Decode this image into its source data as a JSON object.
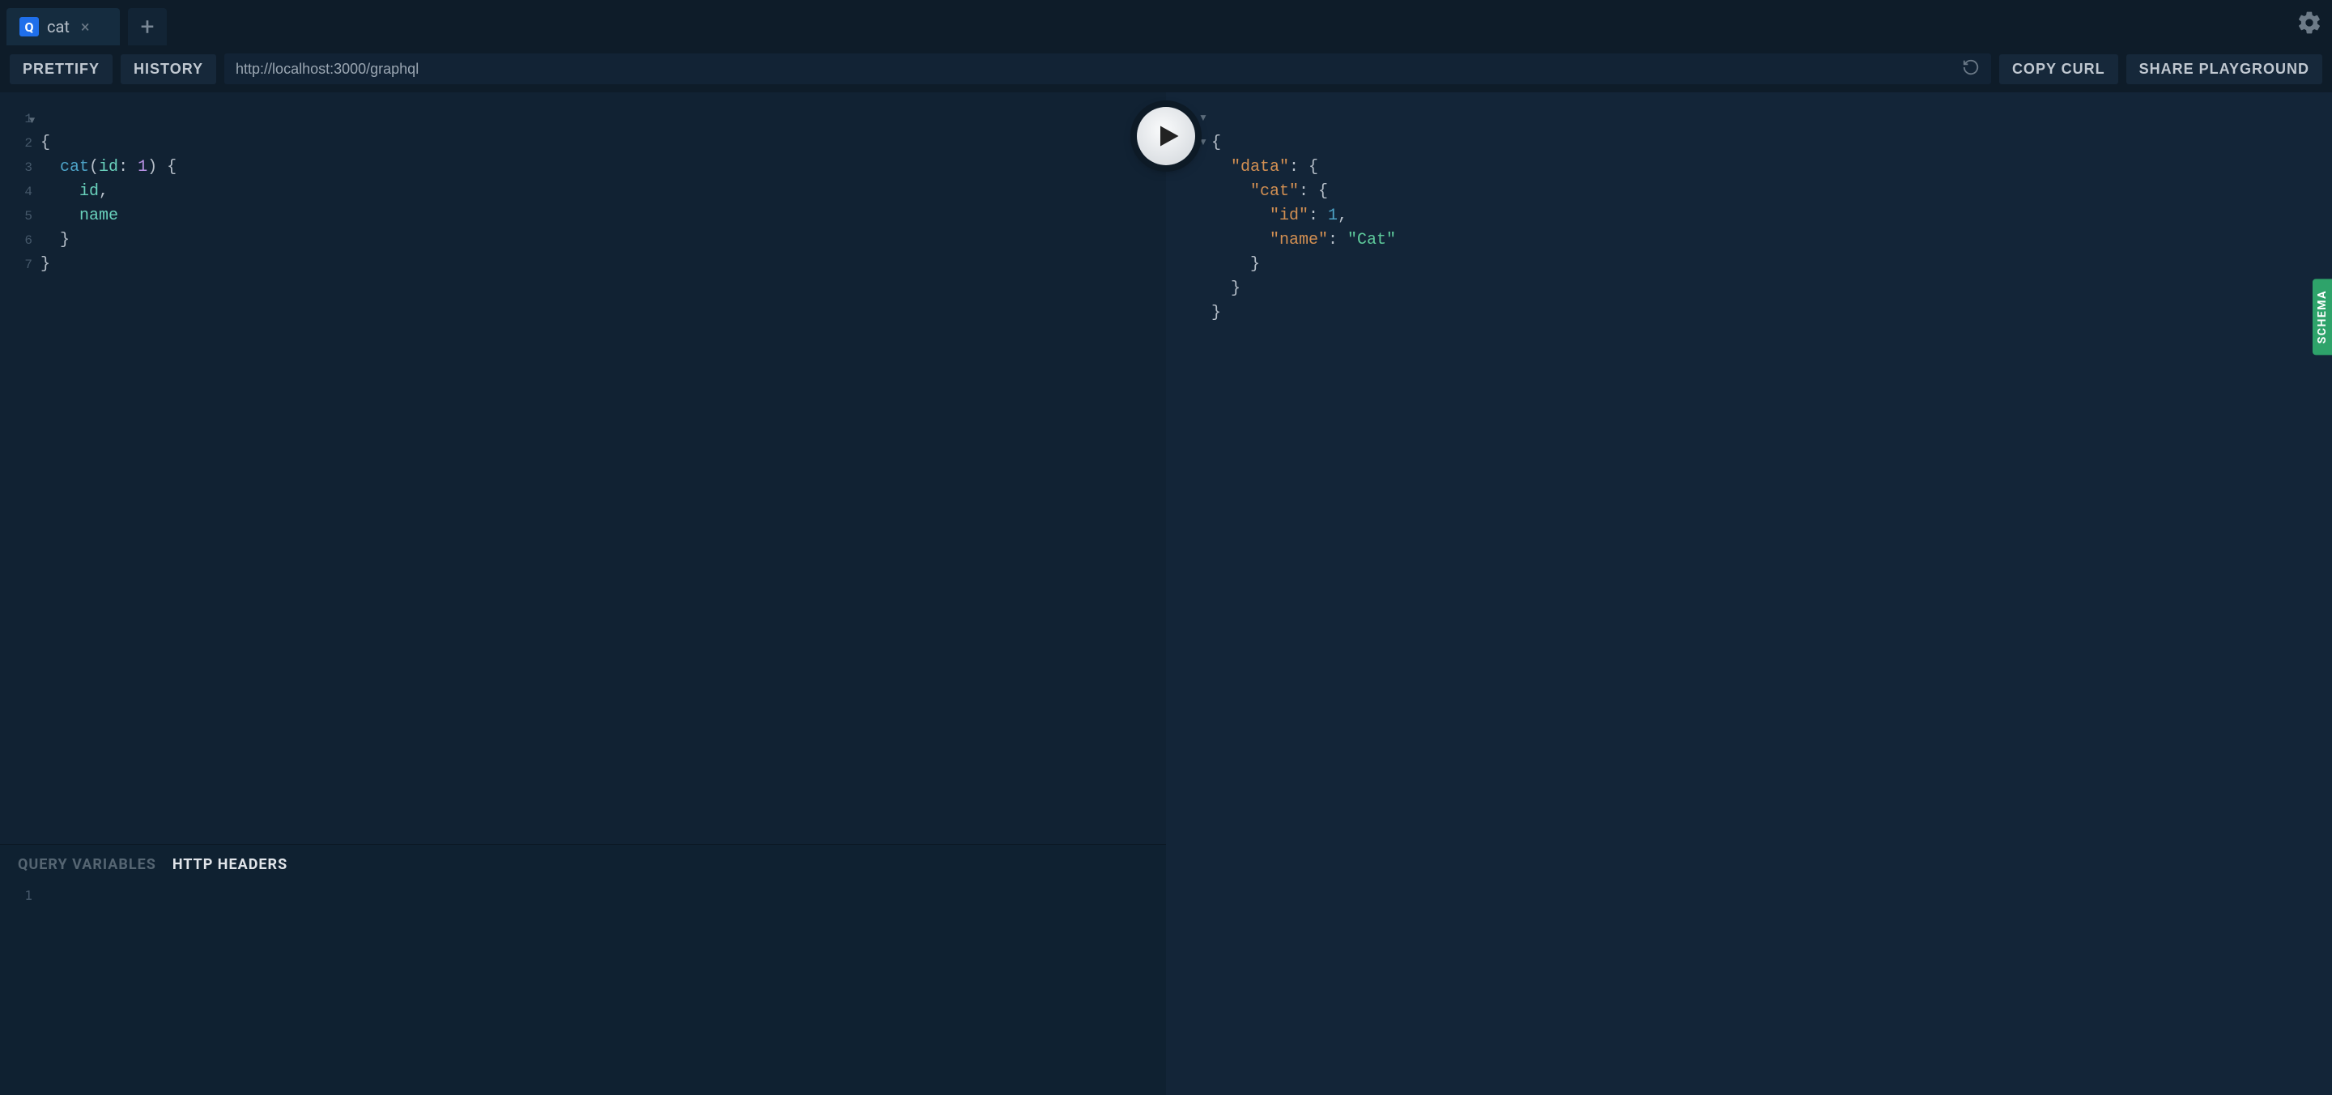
{
  "tabs": [
    {
      "badge": "Q",
      "title": "cat"
    }
  ],
  "toolbar": {
    "prettify": "PRETTIFY",
    "history": "HISTORY",
    "url": "http://localhost:3000/graphql",
    "copy_curl": "COPY CURL",
    "share": "SHARE PLAYGROUND"
  },
  "query": {
    "line_count": 7,
    "tokens": {
      "root": "cat",
      "arg_name": "id",
      "arg_value": "1",
      "field1": "id",
      "field2": "name"
    }
  },
  "response": {
    "data_key": "\"data\"",
    "cat_key": "\"cat\"",
    "id_key": "\"id\"",
    "id_val": "1",
    "name_key": "\"name\"",
    "name_val": "\"Cat\""
  },
  "bottom_panel": {
    "tabs": {
      "vars": "QUERY VARIABLES",
      "headers": "HTTP HEADERS"
    },
    "line1": "1"
  },
  "schema_tab": "SCHEMA",
  "icons": {
    "close": "×",
    "plus": "+"
  }
}
